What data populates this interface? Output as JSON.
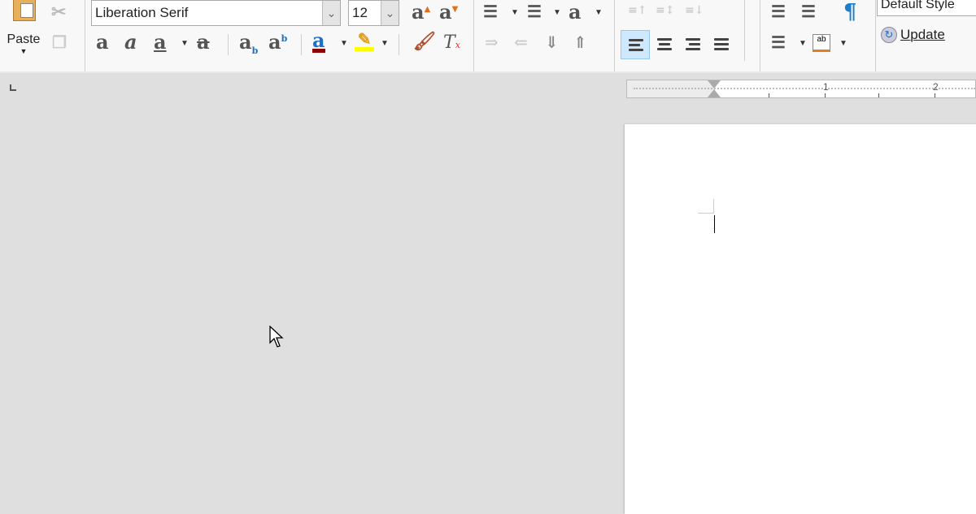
{
  "toolbar": {
    "paste_label": "Paste",
    "font_name": "Liberation Serif",
    "font_size": "12",
    "paragraph_style": "Default Style",
    "update_label": "Update",
    "icons": [
      "clipboard-icon",
      "cut-icon",
      "copy-icon",
      "grow-font-icon",
      "shrink-font-icon",
      "bold-icon",
      "italic-icon",
      "underline-icon",
      "strikethrough-icon",
      "subscript-icon",
      "superscript-icon",
      "font-color-icon",
      "highlight-icon",
      "clone-formatting-icon",
      "clear-formatting-icon",
      "bullet-list-icon",
      "numbered-list-icon",
      "outline-icon",
      "indent-icon",
      "outdent-icon",
      "move-down-icon",
      "move-up-icon",
      "align-left-icon",
      "align-center-icon",
      "align-right-icon",
      "justify-icon",
      "increase-indent-icon",
      "decrease-indent-icon",
      "pilcrow-icon",
      "line-spacing-icon",
      "paragraph-spacing-icon",
      "update-icon"
    ]
  },
  "colors": {
    "font_color": "#8b0000",
    "highlight": "#ffff00",
    "accent": "#cde8ff",
    "pilcrow": "#1e7fc8"
  },
  "ruler": {
    "labels": [
      "1",
      "2"
    ]
  }
}
